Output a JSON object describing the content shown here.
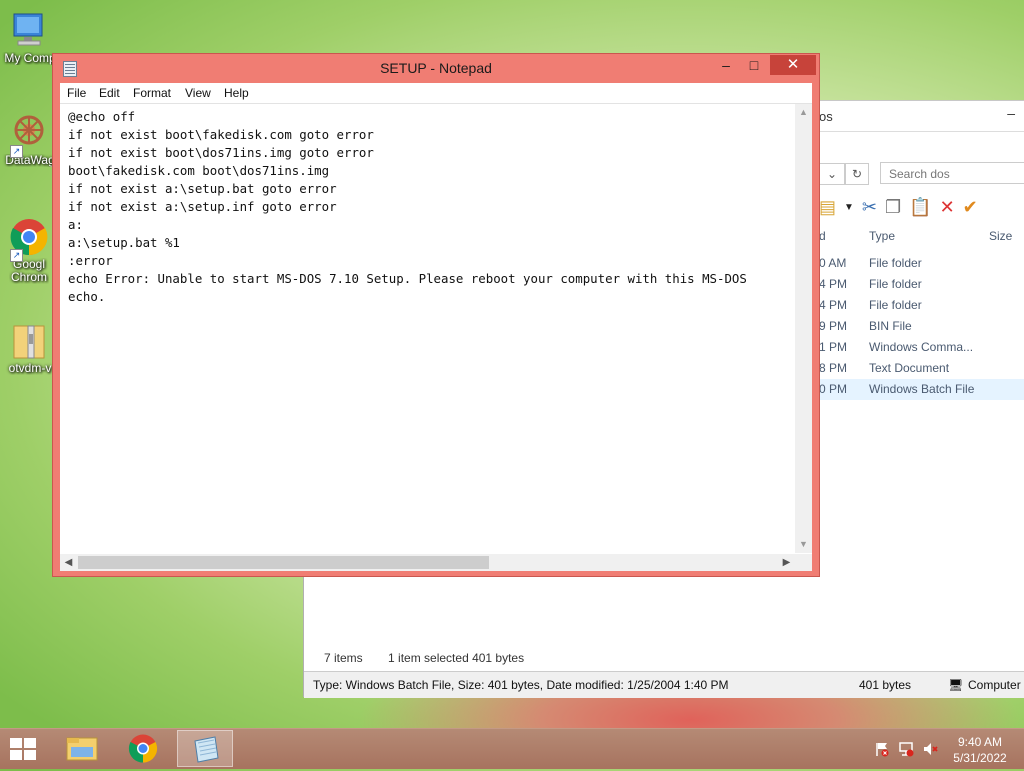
{
  "desktop": {
    "icons": [
      {
        "label": "My Comp",
        "icon": "computer-icon"
      },
      {
        "label": "DataWag",
        "icon": "datawag-app-icon"
      },
      {
        "label": "Googl Chrom",
        "icon": "chrome-icon"
      },
      {
        "label": "otvdm-v",
        "icon": "folder-zip-icon"
      }
    ]
  },
  "explorer": {
    "title": "os",
    "search_placeholder": "Search dos",
    "columns": [
      "d",
      "Type",
      "Size"
    ],
    "rows": [
      {
        "time": "0 AM",
        "type": "File folder"
      },
      {
        "time": "4 PM",
        "type": "File folder"
      },
      {
        "time": "4 PM",
        "type": "File folder"
      },
      {
        "time": "9 PM",
        "type": "BIN File"
      },
      {
        "time": "1 PM",
        "type": "Windows Comma..."
      },
      {
        "time": "8 PM",
        "type": "Text Document"
      },
      {
        "time": "0 PM",
        "type": "Windows Batch File",
        "selected": true
      }
    ],
    "status_items": "7 items",
    "status_selected": "1 item selected  401 bytes",
    "bottom_info": "Type: Windows Batch File, Size: 401 bytes, Date modified: 1/25/2004 1:40 PM",
    "bottom_size": "401 bytes",
    "bottom_location": "Computer"
  },
  "notepad": {
    "title": "SETUP - Notepad",
    "menu": [
      "File",
      "Edit",
      "Format",
      "View",
      "Help"
    ],
    "lines": [
      "@echo off",
      "if not exist boot\\fakedisk.com goto error",
      "if not exist boot\\dos71ins.img goto error",
      "boot\\fakedisk.com boot\\dos71ins.img",
      "if not exist a:\\setup.bat goto error",
      "if not exist a:\\setup.inf goto error",
      "a:",
      "a:\\setup.bat %1",
      ":error",
      "echo Error: Unable to start MS-DOS 7.10 Setup. Please reboot your computer with this MS-DOS",
      "echo."
    ],
    "btn_min": "–",
    "btn_max": "□",
    "btn_close": "✕"
  },
  "taskbar": {
    "apps": [
      {
        "name": "file-explorer",
        "icon": "folder-icon"
      },
      {
        "name": "chrome",
        "icon": "chrome-icon"
      },
      {
        "name": "notepad",
        "icon": "notepad-icon",
        "active": true
      }
    ],
    "time": "9:40 AM",
    "date": "5/31/2022"
  },
  "colors": {
    "notepad_frame": "#f07d73",
    "close_button": "#c7433a",
    "taskbar": "#a7735f",
    "selection": "#e5f3ff"
  }
}
